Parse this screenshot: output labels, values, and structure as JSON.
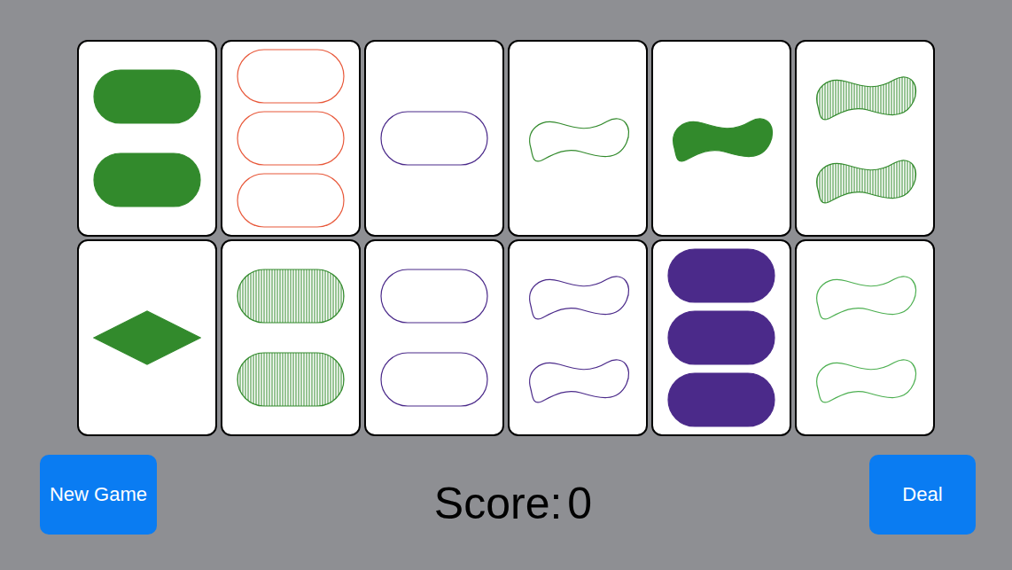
{
  "cards": [
    {
      "count": 2,
      "shape": "oval",
      "shading": "solid",
      "color": "#328a2c"
    },
    {
      "count": 3,
      "shape": "oval",
      "shading": "open",
      "color": "#e8593b"
    },
    {
      "count": 1,
      "shape": "oval",
      "shading": "open",
      "color": "#4b2a8a"
    },
    {
      "count": 1,
      "shape": "squiggle",
      "shading": "open",
      "color": "#328a2c"
    },
    {
      "count": 1,
      "shape": "squiggle",
      "shading": "solid",
      "color": "#328a2c"
    },
    {
      "count": 2,
      "shape": "squiggle",
      "shading": "striped",
      "color": "#328a2c"
    },
    {
      "count": 1,
      "shape": "diamond",
      "shading": "solid",
      "color": "#328a2c"
    },
    {
      "count": 2,
      "shape": "oval",
      "shading": "striped",
      "color": "#328a2c"
    },
    {
      "count": 2,
      "shape": "oval",
      "shading": "open",
      "color": "#4b2a8a"
    },
    {
      "count": 2,
      "shape": "squiggle",
      "shading": "open",
      "color": "#4b2a8a"
    },
    {
      "count": 3,
      "shape": "oval",
      "shading": "solid",
      "color": "#4b2a8a"
    },
    {
      "count": 2,
      "shape": "squiggle",
      "shading": "open",
      "color": "#4caf50"
    }
  ],
  "buttons": {
    "new_game": "New Game",
    "deal": "Deal"
  },
  "score": {
    "label": "Score:",
    "value": "0"
  }
}
